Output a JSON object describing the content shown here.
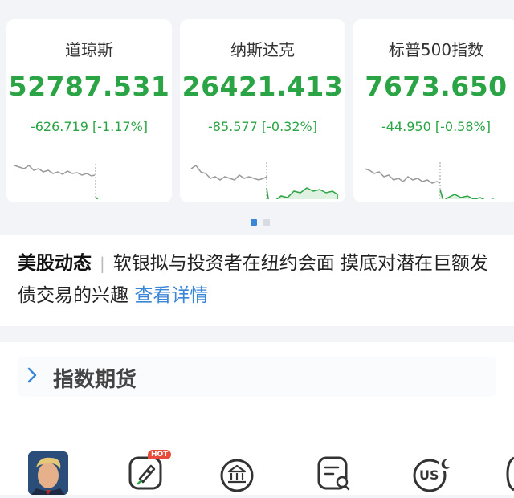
{
  "indices": [
    {
      "name": "道琼斯",
      "price": "52787.531",
      "change": "-626.719 [-1.17%]"
    },
    {
      "name": "纳斯达克",
      "price": "26421.413",
      "change": "-85.577 [-0.32%]"
    },
    {
      "name": "标普500指数",
      "price": "7673.650",
      "change": "-44.950 [-0.58%]"
    }
  ],
  "carousel": {
    "active_page": 1,
    "page_count": 2
  },
  "news": {
    "tag": "美股动态",
    "headline": "软银拟与投资者在纽约会面 摸底对潜在巨额发债交易的兴趣",
    "link": "查看详情"
  },
  "futures": {
    "label": "指数期货"
  },
  "bottom_nav": {
    "hot_badge": "HOT",
    "us_label": "US",
    "icons": [
      "avatar",
      "rocket-icon",
      "bank-icon",
      "document-search-icon",
      "us-market-icon"
    ]
  },
  "colors": {
    "down": "#2aa444",
    "link": "#3a86d8",
    "hot": "#e84a3c",
    "pre_market_line": "#9a9a9a"
  }
}
